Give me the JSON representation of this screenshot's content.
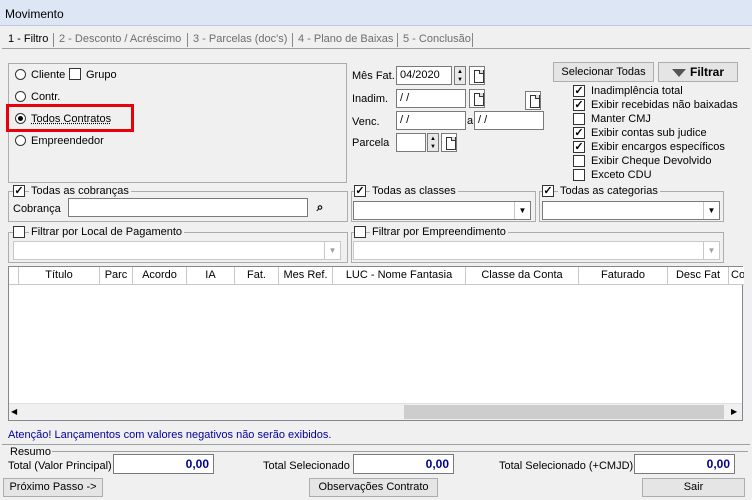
{
  "window": {
    "title": "Movimento"
  },
  "tabs": [
    {
      "label": "1 - Filtro"
    },
    {
      "label": "2 - Desconto / Acréscimo"
    },
    {
      "label": "3 - Parcelas (doc's)"
    },
    {
      "label": "4 - Plano de Baixas"
    },
    {
      "label": "5 - Conclusão"
    }
  ],
  "entity": {
    "cliente": "Cliente",
    "grupo": "Grupo",
    "contr": "Contr.",
    "todos_contratos": "Todos Contratos",
    "empreendedor": "Empreendedor",
    "selected": "todos_contratos"
  },
  "dates": {
    "mes_fat_label": "Mês Fat.",
    "mes_fat_value": "04/2020",
    "inadim_label": "Inadim.",
    "inadim_value": " /  /",
    "venc_label": "Venc.",
    "venc_from": " /  /",
    "venc_sep": "a",
    "venc_to": " /  /",
    "parcela_label": "Parcela",
    "parcela_value": ""
  },
  "options": {
    "select_all_label": "Selecionar Todas",
    "filter_label": "Filtrar",
    "items": [
      {
        "label": "Inadimplência total",
        "checked": true
      },
      {
        "label": "Exibir recebidas não baixadas",
        "checked": true
      },
      {
        "label": "Manter CMJ",
        "checked": false
      },
      {
        "label": "Exibir contas sub judice",
        "checked": true
      },
      {
        "label": "Exibir encargos específicos",
        "checked": true
      },
      {
        "label": "Exibir Cheque Devolvido",
        "checked": false
      },
      {
        "label": "Exceto CDU",
        "checked": false
      }
    ]
  },
  "cobrancas": {
    "group_label": "Todas as cobranças",
    "checked": true,
    "field_label": "Cobrança",
    "value": ""
  },
  "classes": {
    "group_label": "Todas as classes",
    "checked": true,
    "value": ""
  },
  "categorias": {
    "group_label": "Todas as categorias",
    "checked": true,
    "value": ""
  },
  "local_pagamento": {
    "group_label": "Filtrar por Local de Pagamento",
    "checked": false,
    "value": ""
  },
  "empreendimento": {
    "group_label": "Filtrar por Empreendimento",
    "checked": false,
    "value": ""
  },
  "grid": {
    "columns": [
      "Título",
      "Parc",
      "Acordo",
      "IA",
      "Fat.",
      "Mes Ref.",
      "LUC - Nome Fantasia",
      "Classe da Conta",
      "Faturado",
      "Desc Fat",
      "Co"
    ]
  },
  "warning": "Atenção! Lançamentos com valores negativos não serão exibidos.",
  "resumo": {
    "title": "Resumo",
    "total_principal_label": "Total (Valor Principal)",
    "total_principal_value": "0,00",
    "total_selecionado_label": "Total Selecionado",
    "total_selecionado_value": "0,00",
    "total_cmjd_label": "Total Selecionado (+CMJD)",
    "total_cmjd_value": "0,00"
  },
  "footer": {
    "next_label": "Próximo Passo ->",
    "obs_label": "Observações Contrato",
    "exit_label": "Sair"
  },
  "colors": {
    "highlight": "#e8000b",
    "warning_text": "#0000a0",
    "value_text": "#00008b"
  }
}
